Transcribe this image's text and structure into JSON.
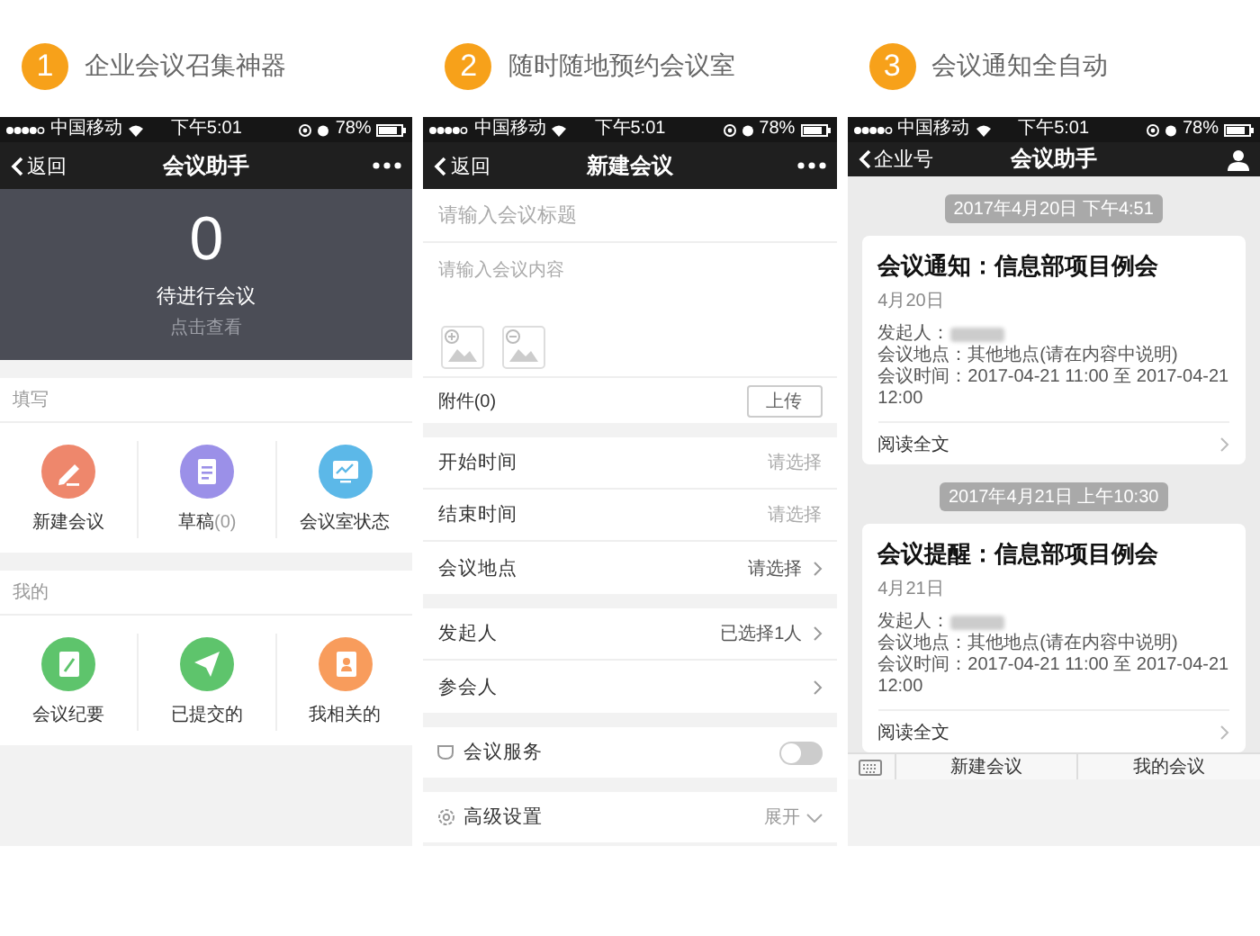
{
  "panels": [
    {
      "kind": "home",
      "step": "1",
      "caption": "企业会议召集神器",
      "status_bar": {
        "carrier": "中国移动",
        "time": "下午5:01",
        "battery": "78%"
      },
      "nav": {
        "back": "返回",
        "title": "会议助手"
      },
      "summary": {
        "count": "0",
        "label": "待进行会议",
        "hint": "点击查看"
      },
      "sections": [
        {
          "title": "填写",
          "items": [
            {
              "kind": "pencil",
              "label": "新建会议",
              "color": "#ee876c"
            },
            {
              "kind": "document",
              "label": "草稿",
              "count": "(0)",
              "color": "#9b90e8"
            },
            {
              "kind": "chart",
              "label": "会议室状态",
              "color": "#5cb8e8"
            }
          ]
        },
        {
          "title": "我的",
          "items": [
            {
              "kind": "note",
              "label": "会议纪要",
              "color": "#5ec46c"
            },
            {
              "kind": "plane",
              "label": "已提交的",
              "color": "#5ec46c"
            },
            {
              "kind": "contact",
              "label": "我相关的",
              "color": "#f89c5c"
            }
          ]
        }
      ]
    },
    {
      "kind": "form",
      "step": "2",
      "caption": "随时随地预约会议室",
      "status_bar": {
        "carrier": "中国移动",
        "time": "下午5:01",
        "battery": "78%"
      },
      "nav": {
        "back": "返回",
        "title": "新建会议"
      },
      "title_field": {
        "placeholder": "请输入会议标题"
      },
      "content_field": {
        "placeholder": "请输入会议内容"
      },
      "attachment": {
        "label": "附件(0)",
        "button": "上传"
      },
      "groups": [
        {
          "rows": [
            {
              "label": "开始时间",
              "placeholder": "请选择",
              "chevron": false
            },
            {
              "label": "结束时间",
              "placeholder": "请选择",
              "chevron": false
            },
            {
              "label": "会议地点",
              "value": "请选择",
              "chevron": true
            }
          ]
        },
        {
          "rows": [
            {
              "label": "发起人",
              "value": "已选择1人",
              "chevron": true
            },
            {
              "label": "参会人",
              "chevron": true
            }
          ]
        }
      ],
      "service": {
        "label": "会议服务",
        "on": false
      },
      "advanced": {
        "label": "高级设置",
        "action": "展开"
      }
    },
    {
      "kind": "feed",
      "step": "3",
      "caption": "会议通知全自动",
      "status_bar": {
        "carrier": "中国移动",
        "time": "下午5:01",
        "battery": "78%"
      },
      "nav": {
        "back": "企业号",
        "title": "会议助手"
      },
      "messages": [
        {
          "timestamp": "2017年4月20日 下午4:51",
          "title": "会议通知：信息部项目例会",
          "date": "4月20日",
          "sender": "发起人：",
          "location": "会议地点：其他地点(请在内容中说明)",
          "time": "会议时间：2017-04-21 11:00 至 2017-04-21 12:00",
          "link": "阅读全文"
        },
        {
          "timestamp": "2017年4月21日 上午10:30",
          "title": "会议提醒：信息部项目例会",
          "date": "4月21日",
          "sender": "发起人：",
          "location": "会议地点：其他地点(请在内容中说明)",
          "time": "会议时间：2017-04-21 11:00 至 2017-04-21 12:00",
          "link": "阅读全文"
        }
      ],
      "bottom_bar": [
        "新建会议",
        "我的会议"
      ]
    }
  ]
}
